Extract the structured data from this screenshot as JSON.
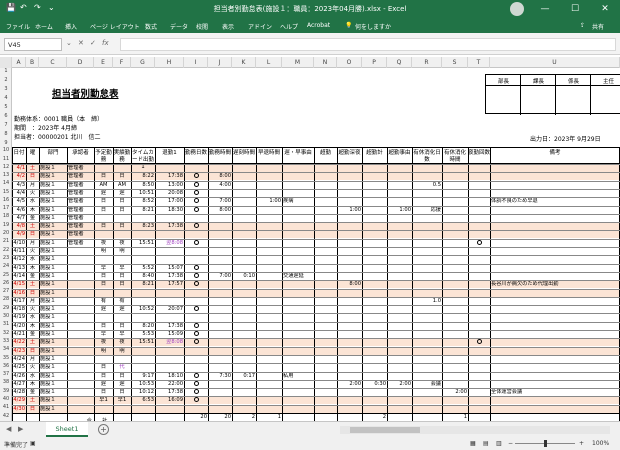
{
  "window": {
    "title": "担当者別勤怠表(施設１：職員：2023年04月勝).xlsx - Excel",
    "user": "共有",
    "ctrl": [
      "—",
      "☐",
      "✕"
    ]
  },
  "ribbon": {
    "tabs": [
      "ファイル",
      "ホーム",
      "挿入",
      "ページ レイアウト",
      "数式",
      "データ",
      "校閲",
      "表示",
      "アドイン",
      "ヘルプ",
      "Acrobat"
    ],
    "search": "何をしますか",
    "share": "共有"
  },
  "formula": {
    "cell": "V45",
    "fx": "fx"
  },
  "columns": [
    "A",
    "B",
    "C",
    "D",
    "E",
    "F",
    "G",
    "H",
    "I",
    "J",
    "K",
    "L",
    "M",
    "N",
    "O",
    "P",
    "Q",
    "R",
    "S",
    "T",
    "U"
  ],
  "sheet": {
    "title": "担当者別勤怠表",
    "info": [
      "勤務体系：0001 職員（本　締）",
      "期間　：2023年 4月締",
      "担当者：00000201 北川　信二"
    ],
    "printed": "出力日：2023年 9月29日",
    "stamps": [
      "部長",
      "課長",
      "係長",
      "主任"
    ],
    "headers": [
      "日付",
      "曜",
      "部門",
      "承認者",
      "予定勤務",
      "実績勤務",
      "タイムカード出勤1",
      "退勤1",
      "勤務日数",
      "勤務時間",
      "遅刻時間",
      "早退時間",
      "遅・早事由",
      "超勤",
      "超勤深夜",
      "超勤計",
      "超勤事由",
      "有休消化日数",
      "有休消化時間",
      "夜勤回数",
      "備考"
    ],
    "rows": [
      [
        "4/1",
        "土",
        "施設１",
        "管理者",
        "",
        "",
        "",
        "",
        "",
        "",
        "",
        "",
        "",
        "",
        "",
        "",
        "",
        "",
        "",
        "",
        ""
      ],
      [
        "4/2",
        "日",
        "施設１",
        "管理者",
        "日",
        "日",
        "8:22",
        "17:38",
        "○",
        "8:00",
        "",
        "",
        "",
        "",
        "",
        "",
        "",
        "",
        "",
        "",
        ""
      ],
      [
        "4/3",
        "月",
        "施設１",
        "管理者",
        "AM",
        "AM",
        "8:50",
        "13:00",
        "○",
        "4:00",
        "",
        "",
        "",
        "",
        "",
        "",
        "",
        "0.5",
        "",
        "",
        ""
      ],
      [
        "4/4",
        "火",
        "施設１",
        "管理者",
        "遅",
        "遅",
        "10:51",
        "20:08",
        "○",
        "",
        "",
        "",
        "",
        "",
        "",
        "",
        "",
        "",
        "",
        "",
        ""
      ],
      [
        "4/5",
        "水",
        "施設１",
        "管理者",
        "日",
        "日",
        "8:52",
        "17:00",
        "○",
        "7:00",
        "",
        "1:00",
        "疾病",
        "",
        "",
        "",
        "",
        "",
        "",
        "",
        "体調不良のため早退"
      ],
      [
        "4/6",
        "木",
        "施設１",
        "管理者",
        "日",
        "日",
        "8:21",
        "18:30",
        "○",
        "8:00",
        "",
        "",
        "",
        "",
        "1:00",
        "",
        "1:00",
        "応援",
        "",
        "",
        ""
      ],
      [
        "4/7",
        "金",
        "施設１",
        "管理者",
        "",
        "",
        "",
        "",
        "",
        "",
        "",
        "",
        "",
        "",
        "",
        "",
        "",
        "",
        "",
        "",
        ""
      ],
      [
        "4/8",
        "土",
        "施設１",
        "管理者",
        "日",
        "日",
        "8:23",
        "17:38",
        "○",
        "",
        "",
        "",
        "",
        "",
        "",
        "",
        "",
        "",
        "",
        "",
        ""
      ],
      [
        "4/9",
        "日",
        "施設１",
        "管理者",
        "",
        "",
        "",
        "",
        "",
        "",
        "",
        "",
        "",
        "",
        "",
        "",
        "",
        "",
        "",
        "",
        ""
      ],
      [
        "4/10",
        "月",
        "施設１",
        "管理者",
        "夜",
        "夜",
        "15:51",
        "翌8:08",
        "○",
        "",
        "",
        "",
        "",
        "",
        "",
        "",
        "",
        "",
        "",
        "○",
        ""
      ],
      [
        "4/11",
        "火",
        "施設１",
        "",
        "明",
        "明",
        "",
        "",
        "",
        "",
        "",
        "",
        "",
        "",
        "",
        "",
        "",
        "",
        "",
        "",
        ""
      ],
      [
        "4/12",
        "水",
        "施設１",
        "",
        "",
        "",
        "",
        "",
        "",
        "",
        "",
        "",
        "",
        "",
        "",
        "",
        "",
        "",
        "",
        "",
        ""
      ],
      [
        "4/13",
        "木",
        "施設１",
        "",
        "早",
        "早",
        "5:52",
        "15:07",
        "○",
        "",
        "",
        "",
        "",
        "",
        "",
        "",
        "",
        "",
        "",
        "",
        ""
      ],
      [
        "4/14",
        "金",
        "施設１",
        "",
        "日",
        "日",
        "8:40",
        "17:38",
        "○",
        "7:00",
        "0:10",
        "",
        "交通遅延",
        "",
        "",
        "",
        "",
        "",
        "",
        "",
        ""
      ],
      [
        "4/15",
        "土",
        "施設１",
        "",
        "日",
        "日",
        "8:21",
        "17:57",
        "○",
        "",
        "",
        "",
        "",
        "",
        "8:00",
        "",
        "",
        "",
        "",
        "",
        "長谷川が病欠のため代理出勤"
      ],
      [
        "4/16",
        "日",
        "施設１",
        "",
        "",
        "",
        "",
        "",
        "",
        "",
        "",
        "",
        "",
        "",
        "",
        "",
        "",
        "",
        "",
        "",
        ""
      ],
      [
        "4/17",
        "月",
        "施設１",
        "",
        "有",
        "有",
        "",
        "",
        "",
        "",
        "",
        "",
        "",
        "",
        "",
        "",
        "",
        "1.0",
        "",
        "",
        ""
      ],
      [
        "4/18",
        "火",
        "施設１",
        "",
        "遅",
        "遅",
        "10:52",
        "20:07",
        "○",
        "",
        "",
        "",
        "",
        "",
        "",
        "",
        "",
        "",
        "",
        "",
        ""
      ],
      [
        "4/19",
        "水",
        "施設１",
        "",
        "",
        "",
        "",
        "",
        "",
        "",
        "",
        "",
        "",
        "",
        "",
        "",
        "",
        "",
        "",
        "",
        ""
      ],
      [
        "4/20",
        "木",
        "施設１",
        "",
        "日",
        "日",
        "8:20",
        "17:38",
        "○",
        "",
        "",
        "",
        "",
        "",
        "",
        "",
        "",
        "",
        "",
        "",
        ""
      ],
      [
        "4/21",
        "金",
        "施設１",
        "",
        "早",
        "早",
        "5:53",
        "15:09",
        "○",
        "",
        "",
        "",
        "",
        "",
        "",
        "",
        "",
        "",
        "",
        "",
        ""
      ],
      [
        "4/22",
        "土",
        "施設１",
        "",
        "夜",
        "夜",
        "15:51",
        "翌8:08",
        "○",
        "",
        "",
        "",
        "",
        "",
        "",
        "",
        "",
        "",
        "",
        "○",
        ""
      ],
      [
        "4/23",
        "日",
        "施設１",
        "",
        "明",
        "明",
        "",
        "",
        "",
        "",
        "",
        "",
        "",
        "",
        "",
        "",
        "",
        "",
        "",
        "",
        ""
      ],
      [
        "4/24",
        "月",
        "施設１",
        "",
        "",
        "",
        "",
        "",
        "",
        "",
        "",
        "",
        "",
        "",
        "",
        "",
        "",
        "",
        "",
        "",
        ""
      ],
      [
        "4/25",
        "火",
        "施設１",
        "",
        "日",
        "代",
        "",
        "",
        "",
        "",
        "",
        "",
        "",
        "",
        "",
        "",
        "",
        "",
        "",
        "",
        ""
      ],
      [
        "4/26",
        "水",
        "施設１",
        "",
        "日",
        "日",
        "9:17",
        "18:10",
        "○",
        "7:30",
        "0:17",
        "",
        "私用",
        "",
        "",
        "",
        "",
        "",
        "",
        "",
        ""
      ],
      [
        "4/27",
        "木",
        "施設１",
        "",
        "遅",
        "遅",
        "10:53",
        "22:00",
        "○",
        "",
        "",
        "",
        "",
        "",
        "2:00",
        "0:30",
        "2:00",
        "会議",
        "",
        "",
        ""
      ],
      [
        "4/28",
        "金",
        "施設１",
        "",
        "日",
        "日",
        "10:12",
        "17:38",
        "○",
        "",
        "",
        "",
        "",
        "",
        "",
        "",
        "",
        "",
        "2:00",
        "",
        "全体運営会議"
      ],
      [
        "4/29",
        "土",
        "施設１",
        "",
        "早1",
        "早1",
        "6:53",
        "16:09",
        "○",
        "",
        "",
        "",
        "",
        "",
        "",
        "",
        "",
        "",
        "",
        "",
        ""
      ],
      [
        "4/30",
        "日",
        "施設１",
        "",
        "",
        "",
        "",
        "",
        "",
        "",
        "",
        "",
        "",
        "",
        "",
        "",
        "",
        "",
        "",
        "",
        ""
      ]
    ],
    "totals": {
      "label": "合　　計",
      "r1": [
        "20",
        "20",
        "2",
        "1",
        "",
        "",
        "2",
        "",
        "1"
      ],
      "r2": [
        "20",
        "157:00",
        "0:27",
        "1:00",
        "",
        "3:00",
        "0:30",
        "11:30",
        "",
        "1.5",
        "2:00",
        "2"
      ]
    }
  },
  "tab": "Sheet1",
  "status": {
    "ready": "準備完了",
    "zoom": "100%"
  }
}
